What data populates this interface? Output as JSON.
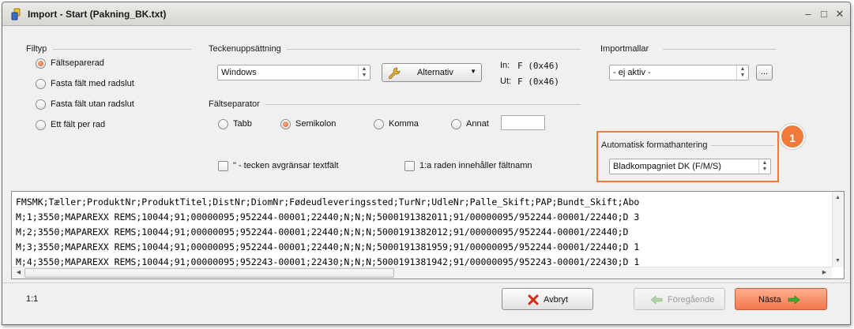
{
  "window": {
    "title": "Import - Start  (Pakning_BK.txt)"
  },
  "filetype": {
    "title": "Filtyp",
    "options": [
      "Fältseparerad",
      "Fasta fält med radslut",
      "Fasta fält utan radslut",
      "Ett fält per rad"
    ],
    "selected": "Fältseparerad"
  },
  "charset": {
    "title": "Teckenuppsättning",
    "value": "Windows",
    "alt_button": "Alternativ",
    "in_label": "In:",
    "in_value": "F (0x46)",
    "out_label": "Ut:",
    "out_value": "F (0x46)"
  },
  "separator": {
    "title": "Fältseparator",
    "options": [
      "Tabb",
      "Semikolon",
      "Komma",
      "Annat"
    ],
    "selected": "Semikolon",
    "other_value": ""
  },
  "checkboxes": {
    "quote": "\" - tecken avgränsar textfält",
    "header": "1:a raden innehåller fältnamn"
  },
  "templates": {
    "title": "Importmallar",
    "value": "- ej aktiv -",
    "more_button": "..."
  },
  "autoformat": {
    "title": "Automatisk formathantering",
    "value": "Bladkompagniet DK (F/M/S)",
    "callout": "1"
  },
  "preview": {
    "lines": [
      "FMSMK;Tæller;ProduktNr;ProduktTitel;DistNr;DiomNr;Fødeudleveringssted;TurNr;UdleNr;Palle_Skift;PAP;Bundt_Skift;Abo",
      "M;1;3550;MAPAREXX REMS;10044;91;00000095;952244-00001;22440;N;N;N;5000191382011;91/00000095/952244-00001/22440;D 3",
      "M;2;3550;MAPAREXX REMS;10044;91;00000095;952244-00001;22440;N;N;N;5000191382012;91/00000095/952244-00001/22440;D",
      "M;3;3550;MAPAREXX REMS;10044;91;00000095;952244-00001;22440;N;N;N;5000191381959;91/00000095/952244-00001/22440;D 1",
      "M;4;3550;MAPAREXX REMS;10044;91;00000095;952243-00001;22430;N;N;N;5000191381942;91/00000095/952243-00001/22430;D 1"
    ]
  },
  "footer": {
    "position": "1:1",
    "cancel": "Avbryt",
    "previous": "Föregående",
    "next": "Nästa"
  },
  "colors": {
    "accent": "#f07a3c",
    "next_button": "#f58a64"
  }
}
